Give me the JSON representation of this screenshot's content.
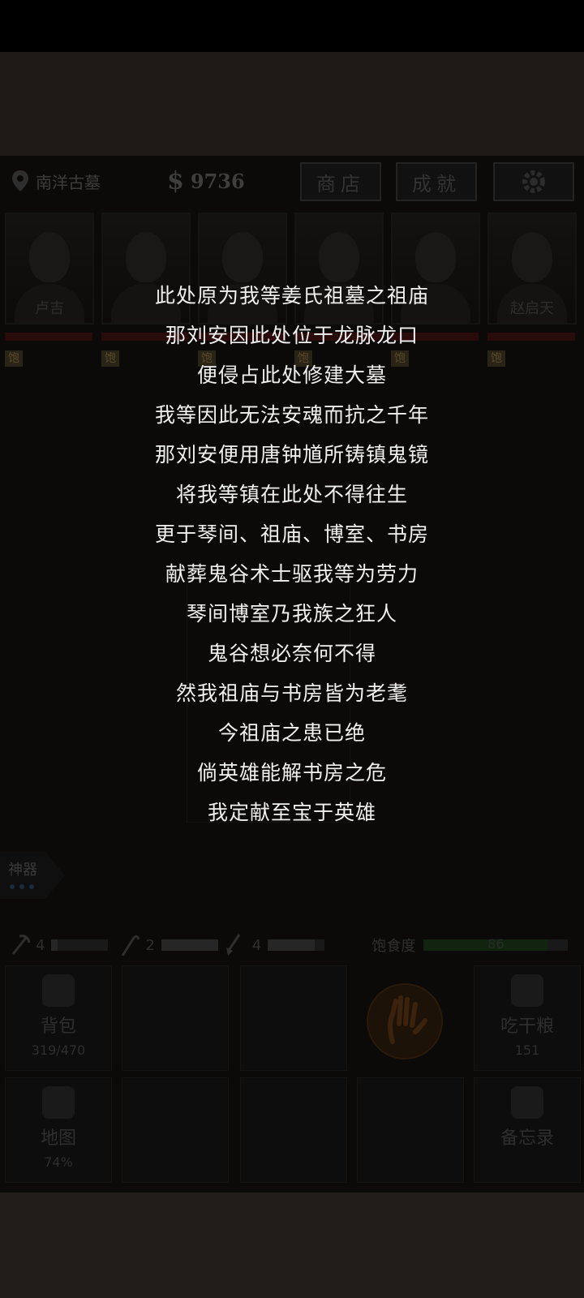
{
  "header": {
    "location": "南洋古墓",
    "money": "9736",
    "shop_label": "商店",
    "achievement_label": "成就"
  },
  "characters": [
    {
      "name": "卢吉"
    },
    {
      "name": ""
    },
    {
      "name": ""
    },
    {
      "name": ""
    },
    {
      "name": ""
    },
    {
      "name": "赵启天"
    }
  ],
  "status_badge": "饱",
  "artifact": {
    "label": "神器"
  },
  "tools": [
    {
      "icon": "pickaxe-icon",
      "count": "4"
    },
    {
      "icon": "hook-icon",
      "count": "2"
    },
    {
      "icon": "shovel-icon",
      "count": "4"
    }
  ],
  "hunger": {
    "label": "饱食度",
    "value": "86",
    "level": 0.86
  },
  "inventory": {
    "backpack_label": "背包",
    "backpack_value": "319/470",
    "rations_label": "吃干粮",
    "rations_value": "151",
    "map_label": "地图",
    "map_value": "74%",
    "memo_label": "备忘录"
  },
  "story": {
    "lines": [
      "此处原为我等姜氏祖墓之祖庙",
      "那刘安因此处位于龙脉龙口",
      "便侵占此处修建大墓",
      "我等因此无法安魂而抗之千年",
      "那刘安便用唐钟馗所铸镇鬼镜",
      "将我等镇在此处不得往生",
      "更于琴间、祖庙、博室、书房",
      "献葬鬼谷术士驱我等为劳力",
      "琴间博室乃我族之狂人",
      "鬼谷想必奈何不得",
      "然我祖庙与书房皆为老耄",
      "今祖庙之患已绝",
      "倘英雄能解书房之危",
      "我定献至宝于英雄"
    ]
  },
  "colors": {
    "overlay_text": "#f0f0f0",
    "hp_bar": "#2a0b0b",
    "hunger_bar": "#10240f"
  }
}
